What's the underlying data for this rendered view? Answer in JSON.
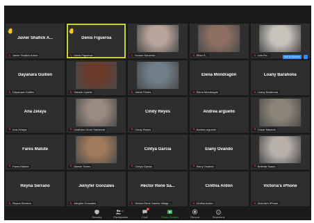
{
  "tiles": [
    {
      "name": "Javier Shafick A...",
      "label": "Javier Shafick Aduro",
      "hand": true
    },
    {
      "name": "Denis Figueroa",
      "label": "Denis Figueroa",
      "hand": true,
      "active": true
    },
    {
      "name": "",
      "label": "Ivonne Saucedo",
      "video": "#b8a59a"
    },
    {
      "name": "",
      "label": "Ritza S...",
      "video": "#8e6f62"
    },
    {
      "name": "",
      "label": "Luis Ro...",
      "video": "#c7c2bb"
    },
    {
      "name": "Dayanara Guillen",
      "label": "Dayanara Guillen"
    },
    {
      "name": "",
      "label": "Yasmin Cyanis",
      "video": "#6a3a2a"
    },
    {
      "name": "",
      "label": "Jaime Flores",
      "video": "#6f7f8a"
    },
    {
      "name": "Elena Mondragón",
      "label": "Elena Mondragón"
    },
    {
      "name": "Loany Barahona",
      "label": "Loany Barahona"
    },
    {
      "name": "Ana Zelaya",
      "label": "Ana Zelaya"
    },
    {
      "name": "",
      "label": "Cristhian Omar Sandoval",
      "video": "#9a8a80"
    },
    {
      "name": "Cindy Reyes",
      "label": "Cindy Reyes"
    },
    {
      "name": "Andrea arguello",
      "label": "Andrea arguello"
    },
    {
      "name": "",
      "label": "César Macedo",
      "video": "#8c8478"
    },
    {
      "name": "Fares Matute",
      "label": "Fares Matute"
    },
    {
      "name": "",
      "label": "Marvin Torres",
      "video": "#a07a5a"
    },
    {
      "name": "Cintya Garcia",
      "label": "Cintya Garcia"
    },
    {
      "name": "Elany Ovando",
      "label": "Elany Ovando"
    },
    {
      "name": "",
      "label": "Belinda Suazo",
      "video": "#b8b0aa"
    },
    {
      "name": "Reyna Serrano",
      "label": "Reyna Serrano"
    },
    {
      "name": "Jeinyfer Gonzales",
      "label": "Jeinyfer Gonzales"
    },
    {
      "name": "Héctor René Sa...",
      "label": "Héctor René Santos Villagr..."
    },
    {
      "name": "Cinthia Ardón",
      "label": "Cinthia Ardón"
    },
    {
      "name": "Victoria's iPhone",
      "label": "Victoria's iPhone"
    }
  ],
  "rename_button": "Ask to Unmute",
  "toolbar": {
    "security": "Security",
    "participants": "Participants",
    "participants_count": "47",
    "chat": "Chat",
    "chat_badge": "1",
    "share": "Share Screen",
    "record": "Record",
    "reactions": "Reactions"
  },
  "colors": {
    "tile_bg": "#2e2e2e",
    "active_border": "#c8d23a",
    "mic_off": "#e0332e",
    "hand": "#f3c623",
    "share": "#2fbf4d"
  }
}
